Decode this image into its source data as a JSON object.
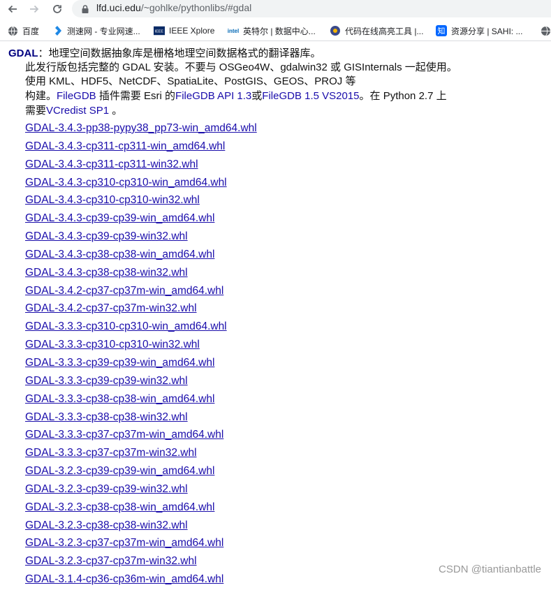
{
  "browser": {
    "url_host": "lfd.uci.edu",
    "url_path": "/~gohlke/pythonlibs/#gdal"
  },
  "bookmarks": [
    {
      "label": "百度",
      "icon": "globe-icon"
    },
    {
      "label": "测速网 - 专业网速...",
      "icon": "speedtest-icon"
    },
    {
      "label": "IEEE Xplore",
      "icon": "ieee-icon"
    },
    {
      "label": "英特尔 | 数据中心...",
      "icon": "intel-icon"
    },
    {
      "label": "代码在线高亮工具 |...",
      "icon": "code-icon"
    },
    {
      "label": "资源分享 | SAHI: ...",
      "icon": "zhihu-icon"
    }
  ],
  "section": {
    "name": "GDAL",
    "title_rest": "：地理空间数据抽象库是栅格地理空间数据格式的翻译器库。",
    "desc_line1": "此发行版包括完整的 GDAL 安装。不要与 OSGeo4W、gdalwin32 或 GISInternals 一起使用。",
    "desc_line2": "使用 KML、HDF5、NetCDF、SpatiaLite、PostGIS、GEOS、PROJ 等",
    "desc_line3_a": "构建。",
    "desc_line3_link1": "FileGDB",
    "desc_line3_b": " 插件需要 Esri 的",
    "desc_line3_link2": "FileGDB API 1.3",
    "desc_line3_c": "或",
    "desc_line3_link3": "FileGDB 1.5 VS2015",
    "desc_line3_d": "。在 Python 2.7 上",
    "desc_line4_a": "需要",
    "desc_line4_link": "VCredist SP1",
    "desc_line4_b": " 。"
  },
  "files": [
    "GDAL-3.4.3-pp38-pypy38_pp73-win_amd64.whl",
    "GDAL-3.4.3-cp311-cp311-win_amd64.whl",
    "GDAL-3.4.3-cp311-cp311-win32.whl",
    "GDAL-3.4.3-cp310-cp310-win_amd64.whl",
    "GDAL-3.4.3-cp310-cp310-win32.whl",
    "GDAL-3.4.3-cp39-cp39-win_amd64.whl",
    "GDAL-3.4.3-cp39-cp39-win32.whl",
    "GDAL-3.4.3-cp38-cp38-win_amd64.whl",
    "GDAL-3.4.3-cp38-cp38-win32.whl",
    "GDAL-3.4.2-cp37-cp37m-win_amd64.whl",
    "GDAL-3.4.2-cp37-cp37m-win32.whl",
    "GDAL-3.3.3-cp310-cp310-win_amd64.whl",
    "GDAL-3.3.3-cp310-cp310-win32.whl",
    "GDAL-3.3.3-cp39-cp39-win_amd64.whl",
    "GDAL-3.3.3-cp39-cp39-win32.whl",
    "GDAL-3.3.3-cp38-cp38-win_amd64.whl",
    "GDAL-3.3.3-cp38-cp38-win32.whl",
    "GDAL-3.3.3-cp37-cp37m-win_amd64.whl",
    "GDAL-3.3.3-cp37-cp37m-win32.whl",
    "GDAL-3.2.3-cp39-cp39-win_amd64.whl",
    "GDAL-3.2.3-cp39-cp39-win32.whl",
    "GDAL-3.2.3-cp38-cp38-win_amd64.whl",
    "GDAL-3.2.3-cp38-cp38-win32.whl",
    "GDAL-3.2.3-cp37-cp37m-win_amd64.whl",
    "GDAL-3.2.3-cp37-cp37m-win32.whl",
    "GDAL-3.1.4-cp36-cp36m-win_amd64.whl"
  ],
  "watermark": "CSDN @tiantianbattle"
}
